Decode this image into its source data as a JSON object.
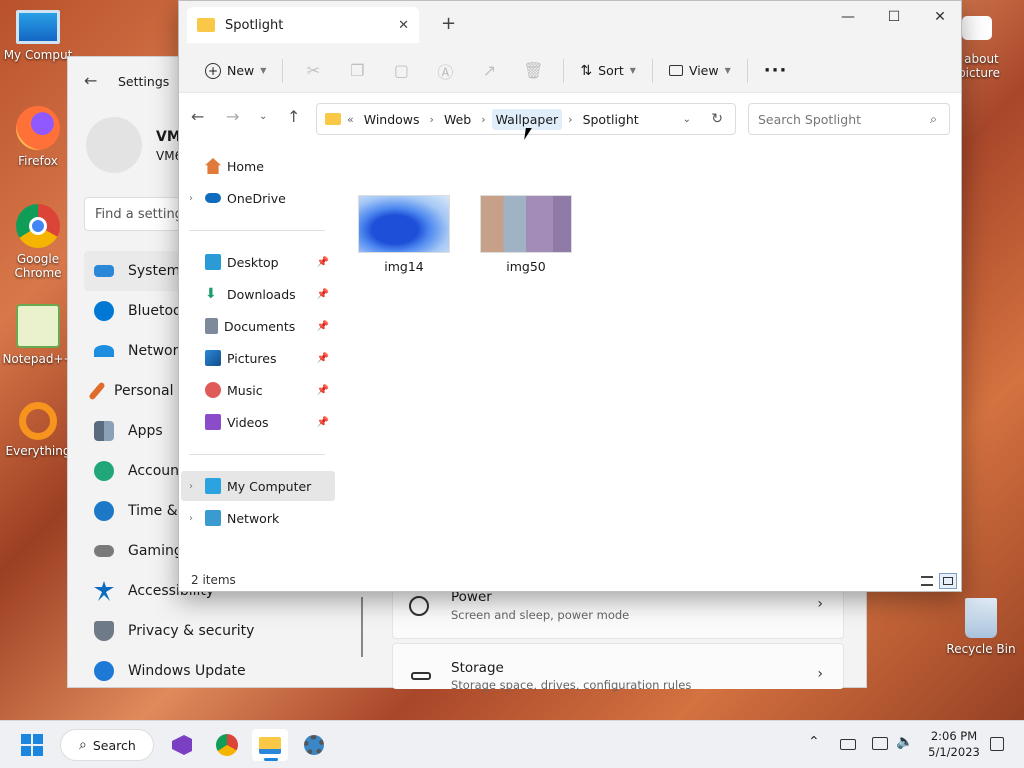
{
  "desktop": {
    "icons": [
      {
        "label": "My Comput"
      },
      {
        "label": "Firefox"
      },
      {
        "label": "Google Chrome"
      },
      {
        "label": "Notepad++"
      },
      {
        "label": "Everything"
      },
      {
        "label": "Recycle Bin"
      }
    ],
    "camera_text": "rn about\ns picture"
  },
  "settings": {
    "title": "Settings",
    "user_name": "VM",
    "user_sub": "VM6",
    "search_placeholder": "Find a setting",
    "nav": [
      "System",
      "Bluetoot",
      "Network",
      "Personal",
      "Apps",
      "Account",
      "Time &",
      "Gaming",
      "Accessibility",
      "Privacy & security",
      "Windows Update"
    ],
    "cards": [
      {
        "title": "Power",
        "sub": "Screen and sleep, power mode"
      },
      {
        "title": "Storage",
        "sub": "Storage space, drives, configuration rules"
      }
    ]
  },
  "explorer": {
    "tab_title": "Spotlight",
    "new_tab": "+",
    "controls": {
      "minimize": "—",
      "maximize": "☐",
      "close": "✕"
    },
    "toolbar": {
      "new": "New",
      "sort": "Sort",
      "view": "View",
      "more": "···"
    },
    "breadcrumb": [
      "Windows",
      "Web",
      "Wallpaper",
      "Spotlight"
    ],
    "search_placeholder": "Search Spotlight",
    "nav": [
      {
        "label": "Home"
      },
      {
        "label": "OneDrive"
      },
      {
        "label": "Desktop"
      },
      {
        "label": "Downloads"
      },
      {
        "label": "Documents"
      },
      {
        "label": "Pictures"
      },
      {
        "label": "Music"
      },
      {
        "label": "Videos"
      },
      {
        "label": "My Computer"
      },
      {
        "label": "Network"
      }
    ],
    "files": [
      {
        "name": "img14"
      },
      {
        "name": "img50"
      }
    ],
    "status": "2 items"
  },
  "taskbar": {
    "search_label": "Search",
    "time": "2:06 PM",
    "date": "5/1/2023"
  }
}
